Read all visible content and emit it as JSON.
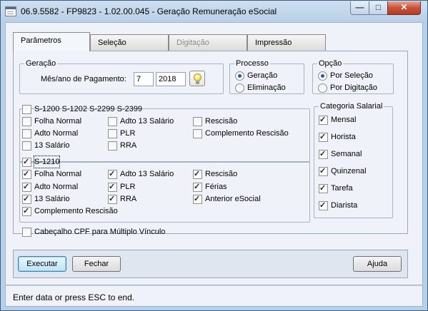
{
  "window": {
    "title": "06.9.5582 - FP9823 - 1.02.00.045 - Geração Remuneração eSocial"
  },
  "tabs": [
    {
      "label": "Parâmetros",
      "state": "active"
    },
    {
      "label": "Seleção",
      "state": "normal"
    },
    {
      "label": "Digitação",
      "state": "disabled"
    },
    {
      "label": "Impressão",
      "state": "normal"
    }
  ],
  "geracao": {
    "legend": "Geração",
    "mes_ano_label": "Mês/ano de Pagamento:",
    "mes_value": "7",
    "ano_value": "2018",
    "lookup_icon": "lightbulb-icon"
  },
  "processo": {
    "legend": "Processo",
    "options": [
      {
        "label": "Geração",
        "selected": true
      },
      {
        "label": "Eliminação",
        "selected": false
      }
    ]
  },
  "opcao": {
    "legend": "Opção",
    "options": [
      {
        "label": "Por Seleção",
        "selected": true
      },
      {
        "label": "Por Digitação",
        "selected": false
      }
    ]
  },
  "grp_s1200": {
    "legend": "S-1200 S-1202 S-2299 S-2399",
    "checked": false,
    "items": [
      {
        "label": "Folha Normal",
        "checked": false
      },
      {
        "label": "Adto 13 Salário",
        "checked": false
      },
      {
        "label": "Rescisão",
        "checked": false
      },
      {
        "label": "Adto Normal",
        "checked": false
      },
      {
        "label": "PLR",
        "checked": false
      },
      {
        "label": "Complemento Rescisão",
        "checked": false
      },
      {
        "label": "13 Salário",
        "checked": false
      },
      {
        "label": "RRA",
        "checked": false
      }
    ]
  },
  "grp_s1210": {
    "legend": "S-1210",
    "checked": true,
    "items": [
      {
        "label": "Folha Normal",
        "checked": true
      },
      {
        "label": "Adto 13 Salário",
        "checked": true
      },
      {
        "label": "Rescisão",
        "checked": true
      },
      {
        "label": "Adto Normal",
        "checked": true
      },
      {
        "label": "PLR",
        "checked": true
      },
      {
        "label": "Férias",
        "checked": true
      },
      {
        "label": "13 Salário",
        "checked": true
      },
      {
        "label": "RRA",
        "checked": true
      },
      {
        "label": "Anterior eSocial",
        "checked": true
      },
      {
        "label": "Complemento Rescisão",
        "checked": true
      }
    ]
  },
  "cabecalho": {
    "label": "Cabeçalho CPF para Múltiplo Vínculo",
    "checked": false
  },
  "categoria": {
    "legend": "Categoria Salarial",
    "items": [
      {
        "label": "Mensal",
        "checked": true
      },
      {
        "label": "Horista",
        "checked": true
      },
      {
        "label": "Semanal",
        "checked": true
      },
      {
        "label": "Quinzenal",
        "checked": true
      },
      {
        "label": "Tarefa",
        "checked": true
      },
      {
        "label": "Diarista",
        "checked": true
      }
    ]
  },
  "buttons": {
    "executar": "Executar",
    "fechar": "Fechar",
    "ajuda": "Ajuda"
  },
  "status": "Enter data or press ESC to end.",
  "glyphs": {
    "check": "✓",
    "minimize": "—",
    "maximize": "□",
    "close": "✕"
  }
}
